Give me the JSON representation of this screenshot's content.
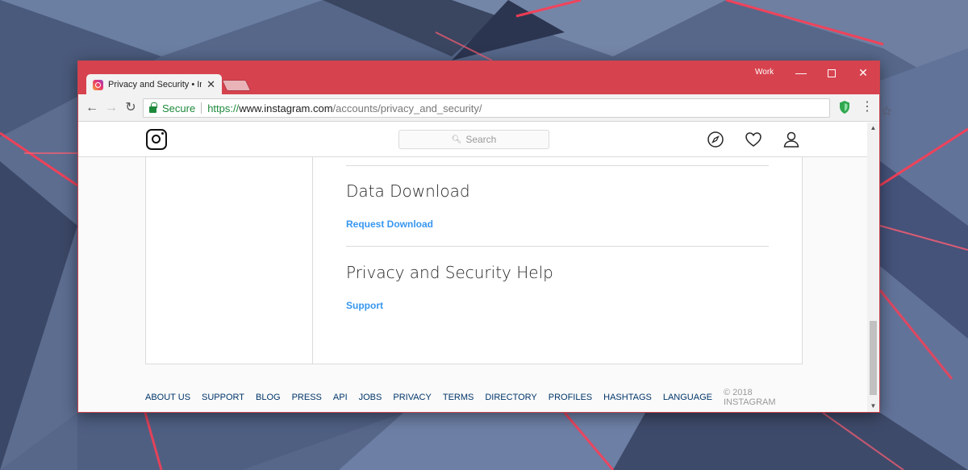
{
  "browser": {
    "tab_title": "Privacy and Security • Ins",
    "profile_label": "Work",
    "secure_label": "Secure",
    "url_scheme": "https://",
    "url_host": "www.instagram.com",
    "url_path": "/accounts/privacy_and_security/"
  },
  "instagram": {
    "search_placeholder": "Search",
    "sections": [
      {
        "title": "Data Download",
        "link": "Request Download"
      },
      {
        "title": "Privacy and Security Help",
        "link": "Support"
      }
    ],
    "footer_links": [
      "ABOUT US",
      "SUPPORT",
      "BLOG",
      "PRESS",
      "API",
      "JOBS",
      "PRIVACY",
      "TERMS",
      "DIRECTORY",
      "PROFILES",
      "HASHTAGS",
      "LANGUAGE"
    ],
    "copyright": "© 2018 INSTAGRAM"
  },
  "colors": {
    "titlebar": "#d6434f",
    "link": "#3897f0",
    "secure_green": "#1e8a3c"
  }
}
